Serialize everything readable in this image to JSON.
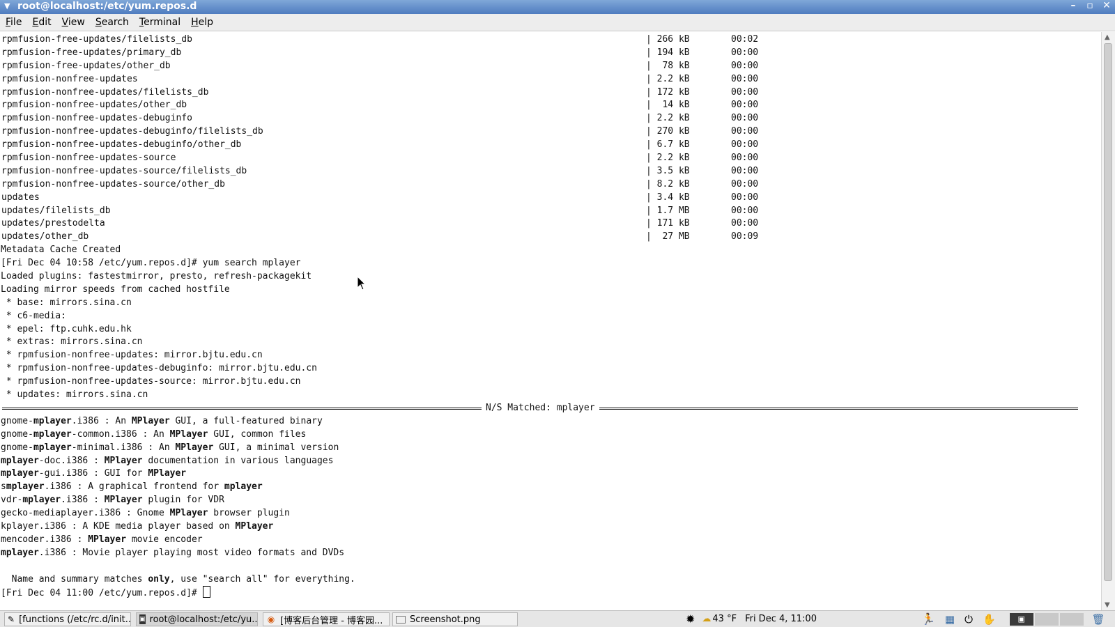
{
  "window": {
    "title": "root@localhost:/etc/yum.repos.d",
    "menu_arrow_icon": "menu-arrow-icon",
    "controls": [
      "–",
      "▫",
      "✕"
    ]
  },
  "menu": [
    "File",
    "Edit",
    "View",
    "Search",
    "Terminal",
    "Help"
  ],
  "repo_rows": [
    {
      "name": "rpmfusion-free-updates/filelists_db",
      "size": "266 kB",
      "time": "00:02"
    },
    {
      "name": "rpmfusion-free-updates/primary_db",
      "size": "194 kB",
      "time": "00:00"
    },
    {
      "name": "rpmfusion-free-updates/other_db",
      "size": " 78 kB",
      "time": "00:00"
    },
    {
      "name": "rpmfusion-nonfree-updates",
      "size": "2.2 kB",
      "time": "00:00"
    },
    {
      "name": "rpmfusion-nonfree-updates/filelists_db",
      "size": "172 kB",
      "time": "00:00"
    },
    {
      "name": "rpmfusion-nonfree-updates/other_db",
      "size": " 14 kB",
      "time": "00:00"
    },
    {
      "name": "rpmfusion-nonfree-updates-debuginfo",
      "size": "2.2 kB",
      "time": "00:00"
    },
    {
      "name": "rpmfusion-nonfree-updates-debuginfo/filelists_db",
      "size": "270 kB",
      "time": "00:00"
    },
    {
      "name": "rpmfusion-nonfree-updates-debuginfo/other_db",
      "size": "6.7 kB",
      "time": "00:00"
    },
    {
      "name": "rpmfusion-nonfree-updates-source",
      "size": "2.2 kB",
      "time": "00:00"
    },
    {
      "name": "rpmfusion-nonfree-updates-source/filelists_db",
      "size": "3.5 kB",
      "time": "00:00"
    },
    {
      "name": "rpmfusion-nonfree-updates-source/other_db",
      "size": "8.2 kB",
      "time": "00:00"
    },
    {
      "name": "updates",
      "size": "3.4 kB",
      "time": "00:00"
    },
    {
      "name": "updates/filelists_db",
      "size": "1.7 MB",
      "time": "00:00"
    },
    {
      "name": "updates/prestodelta",
      "size": "171 kB",
      "time": "00:00"
    },
    {
      "name": "updates/other_db",
      "size": " 27 MB",
      "time": "00:09"
    }
  ],
  "output_lines": [
    "Metadata Cache Created",
    "[Fri Dec 04 10:58 /etc/yum.repos.d]# yum search mplayer",
    "Loaded plugins: fastestmirror, presto, refresh-packagekit",
    "Loading mirror speeds from cached hostfile",
    " * base: mirrors.sina.cn",
    " * c6-media:",
    " * epel: ftp.cuhk.edu.hk",
    " * extras: mirrors.sina.cn",
    " * rpmfusion-nonfree-updates: mirror.bjtu.edu.cn",
    " * rpmfusion-nonfree-updates-debuginfo: mirror.bjtu.edu.cn",
    " * rpmfusion-nonfree-updates-source: mirror.bjtu.edu.cn",
    " * updates: mirrors.sina.cn"
  ],
  "separator_label": "N/S Matched: mplayer",
  "search_results": [
    [
      {
        "t": "gnome-"
      },
      {
        "t": "mplayer",
        "b": true
      },
      {
        "t": ".i386 : An "
      },
      {
        "t": "MPlayer",
        "b": true
      },
      {
        "t": " GUI, a full-featured binary"
      }
    ],
    [
      {
        "t": "gnome-"
      },
      {
        "t": "mplayer",
        "b": true
      },
      {
        "t": "-common.i386 : An "
      },
      {
        "t": "MPlayer",
        "b": true
      },
      {
        "t": " GUI, common files"
      }
    ],
    [
      {
        "t": "gnome-"
      },
      {
        "t": "mplayer",
        "b": true
      },
      {
        "t": "-minimal.i386 : An "
      },
      {
        "t": "MPlayer",
        "b": true
      },
      {
        "t": " GUI, a minimal version"
      }
    ],
    [
      {
        "t": "mplayer",
        "b": true
      },
      {
        "t": "-doc.i386 : "
      },
      {
        "t": "MPlayer",
        "b": true
      },
      {
        "t": " documentation in various languages"
      }
    ],
    [
      {
        "t": "mplayer",
        "b": true
      },
      {
        "t": "-gui.i386 : GUI for "
      },
      {
        "t": "MPlayer",
        "b": true
      }
    ],
    [
      {
        "t": "s"
      },
      {
        "t": "mplayer",
        "b": true
      },
      {
        "t": ".i386 : A graphical frontend for "
      },
      {
        "t": "mplayer",
        "b": true
      }
    ],
    [
      {
        "t": "vdr-"
      },
      {
        "t": "mplayer",
        "b": true
      },
      {
        "t": ".i386 : "
      },
      {
        "t": "MPlayer",
        "b": true
      },
      {
        "t": " plugin for VDR"
      }
    ],
    [
      {
        "t": "gecko-mediaplayer.i386 : Gnome "
      },
      {
        "t": "MPlayer",
        "b": true
      },
      {
        "t": " browser plugin"
      }
    ],
    [
      {
        "t": "kplayer.i386 : A KDE media player based on "
      },
      {
        "t": "MPlayer",
        "b": true
      }
    ],
    [
      {
        "t": "mencoder.i386 : "
      },
      {
        "t": "MPlayer",
        "b": true
      },
      {
        "t": " movie encoder"
      }
    ],
    [
      {
        "t": "mplayer",
        "b": true
      },
      {
        "t": ".i386 : Movie player playing most video formats and DVDs"
      }
    ]
  ],
  "footer_note": [
    {
      "t": "  Name and summary matches "
    },
    {
      "t": "only",
      "b": true
    },
    {
      "t": ", use \"search all\" for everything."
    }
  ],
  "prompt": "[Fri Dec 04 11:00 /etc/yum.repos.d]# ",
  "taskbar": {
    "tasks": [
      {
        "label": "[functions (/etc/rc.d/init...",
        "icon": "editor-icon"
      },
      {
        "label": "root@localhost:/etc/yu...",
        "icon": "terminal-icon",
        "active": true
      },
      {
        "label": "[博客后台管理 - 博客园...",
        "icon": "firefox-icon"
      },
      {
        "label": "Screenshot.png",
        "icon": "image-icon"
      }
    ],
    "weather": "43 °F",
    "clock": "Fri Dec 4, 11:00"
  }
}
